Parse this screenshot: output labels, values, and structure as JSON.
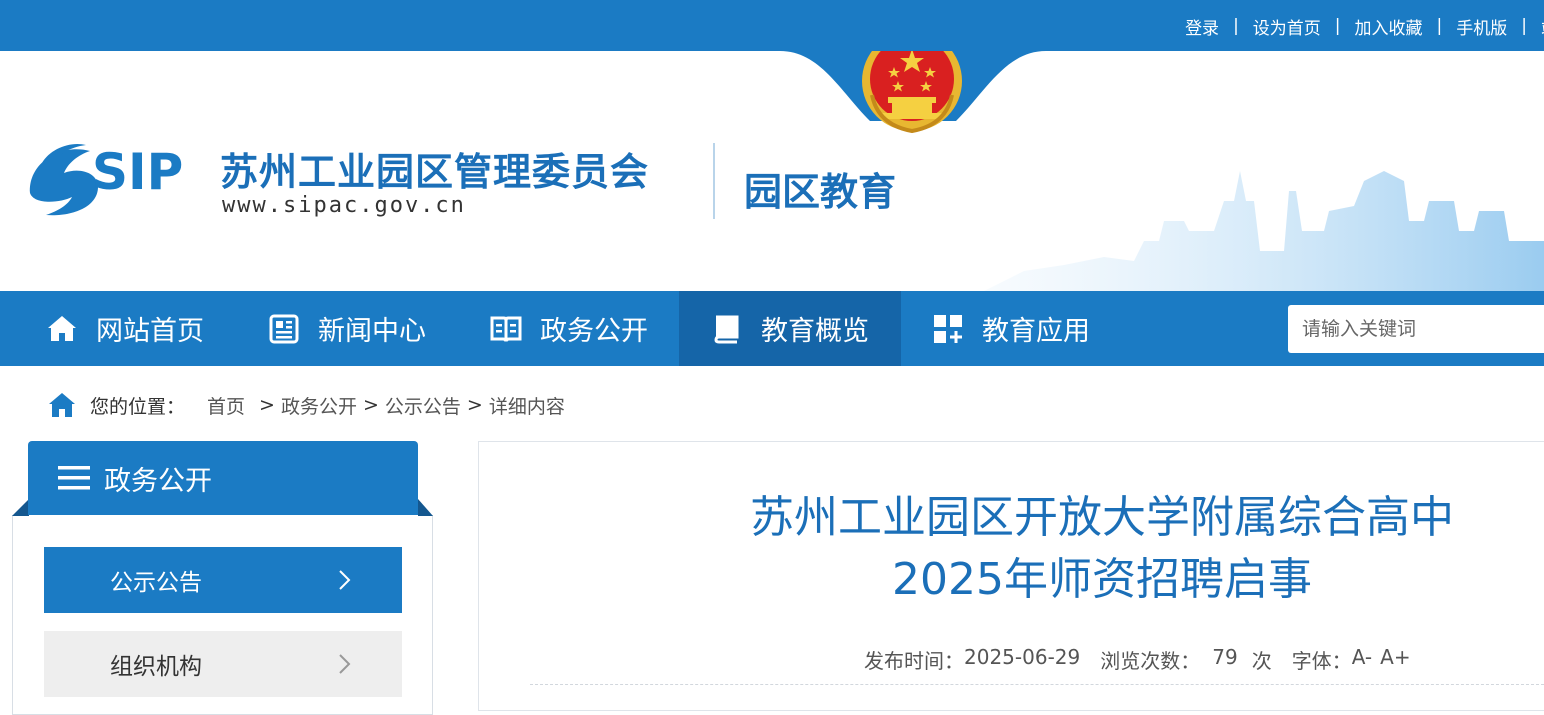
{
  "top_links": [
    "登录",
    "设为首页",
    "加入收藏",
    "手机版",
    "站"
  ],
  "header": {
    "logo_text": "SIP",
    "org_name": "苏州工业园区管理委员会",
    "org_url": "www.sipac.gov.cn",
    "section_name": "园区教育"
  },
  "nav": {
    "items": [
      {
        "label": "网站首页",
        "icon": "home-icon"
      },
      {
        "label": "新闻中心",
        "icon": "newspaper-icon"
      },
      {
        "label": "政务公开",
        "icon": "book-open-icon"
      },
      {
        "label": "教育概览",
        "icon": "book-icon"
      },
      {
        "label": "教育应用",
        "icon": "apps-icon"
      }
    ],
    "active_label": "教育概览",
    "search_placeholder": "请输入关键词"
  },
  "breadcrumb": {
    "label": "您的位置：",
    "items": [
      "首页",
      "政务公开",
      "公示公告",
      "详细内容"
    ]
  },
  "sidebar": {
    "title": "政务公开",
    "items": [
      {
        "label": "公示公告",
        "active": true
      },
      {
        "label": "组织机构",
        "active": false
      }
    ]
  },
  "article": {
    "title_line1": "苏州工业园区开放大学附属综合高中",
    "title_line2": "2025年师资招聘启事",
    "meta": {
      "publish_label": "发布时间：",
      "publish_date": "2025-06-29",
      "views_label": "浏览次数：",
      "views_count": "79",
      "views_unit": "次",
      "font_label": "字体：",
      "font_smaller": "A-",
      "font_larger": "A+"
    }
  },
  "colors": {
    "primary": "#1b7bc4",
    "primary_dark": "#1565a8",
    "title_blue": "#1b6fb8"
  }
}
